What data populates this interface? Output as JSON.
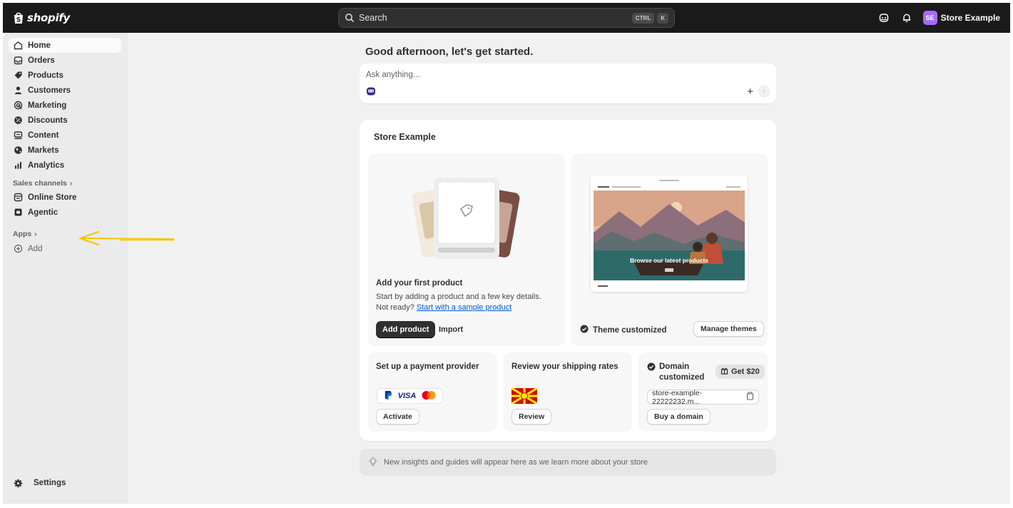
{
  "brand": {
    "name": "shopify"
  },
  "search": {
    "label": "Search",
    "shortcut_keys": [
      "CTRL",
      "K"
    ]
  },
  "header": {
    "store_initials": "SE",
    "store_name": "Store Example"
  },
  "sidebar": {
    "items": [
      {
        "label": "Home",
        "icon": "home-icon",
        "active": true
      },
      {
        "label": "Orders",
        "icon": "inbox-icon"
      },
      {
        "label": "Products",
        "icon": "tag-icon"
      },
      {
        "label": "Customers",
        "icon": "person-icon"
      },
      {
        "label": "Marketing",
        "icon": "target-icon"
      },
      {
        "label": "Discounts",
        "icon": "discount-icon"
      },
      {
        "label": "Content",
        "icon": "content-icon"
      },
      {
        "label": "Markets",
        "icon": "globe-icon"
      },
      {
        "label": "Analytics",
        "icon": "bar-chart-icon"
      }
    ],
    "sales_channels_label": "Sales channels",
    "channels": [
      {
        "label": "Online Store",
        "icon": "store-icon"
      },
      {
        "label": "Agentic",
        "icon": "agentic-icon"
      }
    ],
    "apps_label": "Apps",
    "add_label": "Add",
    "settings_label": "Settings"
  },
  "main": {
    "greeting": "Good afternoon, let's get started.",
    "ask_placeholder": "Ask anything...",
    "store_card": {
      "title": "Store Example",
      "product": {
        "title": "Add your first product",
        "desc": "Start by adding a product and a few key details. Not ready?",
        "link": "Start with a sample product",
        "primary": "Add product",
        "secondary": "Import"
      },
      "theme": {
        "preview_caption": "Browse our latest products",
        "status": "Theme customized",
        "button": "Manage themes"
      },
      "payment": {
        "title": "Set up a payment provider",
        "visa_label": "VISA",
        "button": "Activate"
      },
      "shipping": {
        "title": "Review your shipping rates",
        "button": "Review"
      },
      "domain": {
        "title_line1": "Domain",
        "title_line2": "customized",
        "badge": "Get $20",
        "field": "store-example-22222232.m...",
        "button": "Buy a domain"
      }
    },
    "insight": "New insights and guides will appear here as we learn more about your store"
  },
  "colors": {
    "topbar": "#1a1a1a",
    "accent_link": "#005bd3",
    "avatar": "#a66bff",
    "annotation_arrow": "#f5c400"
  }
}
